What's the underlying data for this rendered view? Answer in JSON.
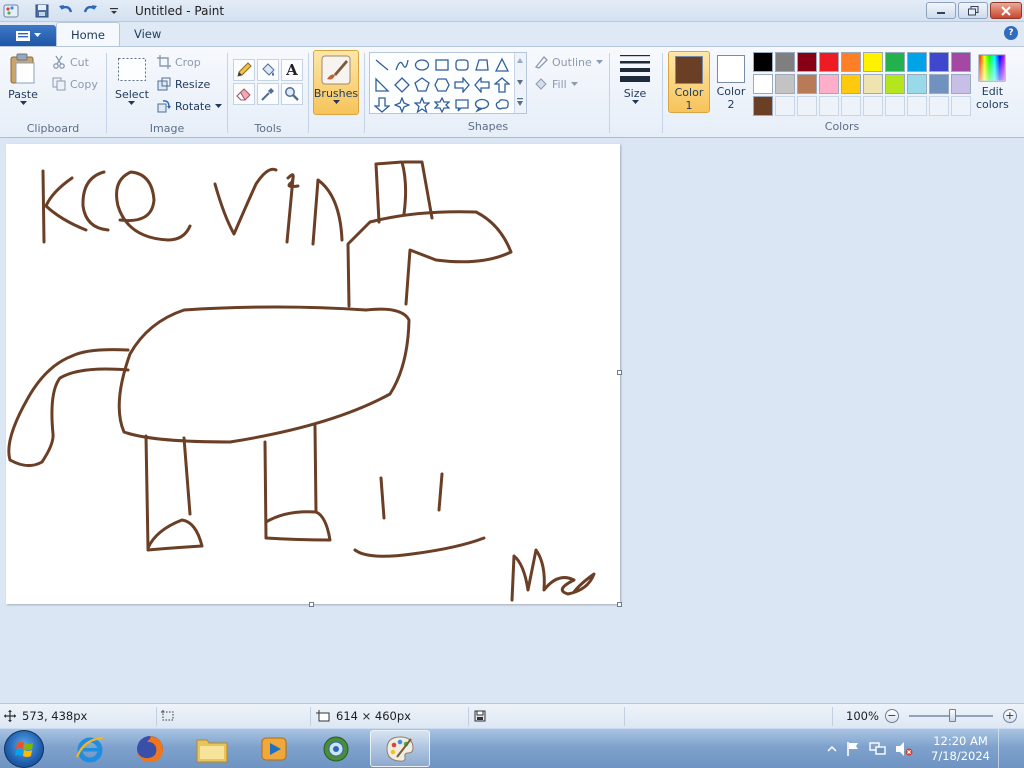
{
  "window": {
    "title": "Untitled - Paint"
  },
  "tabs": [
    {
      "label": "Home"
    },
    {
      "label": "View"
    }
  ],
  "help_icon": "?",
  "clipboard": {
    "paste_label": "Paste",
    "cut_label": "Cut",
    "copy_label": "Copy",
    "group_label": "Clipboard"
  },
  "image": {
    "select_label": "Select",
    "crop_label": "Crop",
    "resize_label": "Resize",
    "rotate_label": "Rotate",
    "group_label": "Image"
  },
  "tools": {
    "group_label": "Tools",
    "text_tool_glyph": "A"
  },
  "brushes": {
    "label": "Brushes"
  },
  "shapes": {
    "outline_label": "Outline",
    "fill_label": "Fill",
    "group_label": "Shapes"
  },
  "size": {
    "label": "Size"
  },
  "colors": {
    "color1_label_a": "Color",
    "color1_label_b": "1",
    "color2_label_a": "Color",
    "color2_label_b": "2",
    "color1_value": "#6b3f26",
    "color2_value": "#ffffff",
    "edit_label_a": "Edit",
    "edit_label_b": "colors",
    "group_label": "Colors",
    "palette": [
      "#000000",
      "#7f7f7f",
      "#880015",
      "#ed1c24",
      "#ff7f27",
      "#fff200",
      "#22b14c",
      "#00a2e8",
      "#3f48cc",
      "#a349a4",
      "#ffffff",
      "#c3c3c3",
      "#b97a57",
      "#ffaec9",
      "#ffc90e",
      "#efe4b0",
      "#b5e61d",
      "#99d9ea",
      "#7092be",
      "#c8bfe7",
      "#6b3f26",
      "",
      "",
      "",
      "",
      "",
      "",
      "",
      "",
      ""
    ]
  },
  "drawing": {
    "stroke_color": "#6b3f26"
  },
  "status": {
    "cursor_pos": "573, 438px",
    "canvas_size": "614 × 460px",
    "zoom": "100%"
  },
  "taskbar": {
    "time": "12:20 AM",
    "date": "7/18/2024"
  }
}
